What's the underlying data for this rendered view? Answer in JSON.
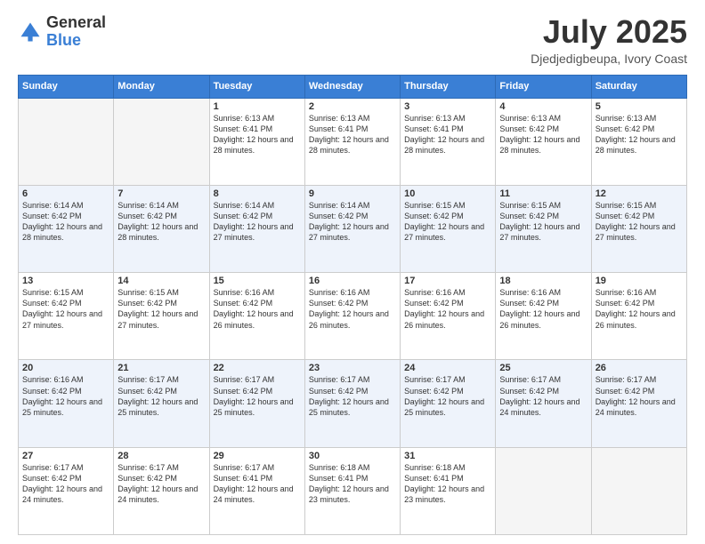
{
  "logo": {
    "text_general": "General",
    "text_blue": "Blue"
  },
  "title": {
    "month_year": "July 2025",
    "location": "Djedjedigbeupa, Ivory Coast"
  },
  "weekdays": [
    "Sunday",
    "Monday",
    "Tuesday",
    "Wednesday",
    "Thursday",
    "Friday",
    "Saturday"
  ],
  "weeks": [
    [
      {
        "day": "",
        "info": ""
      },
      {
        "day": "",
        "info": ""
      },
      {
        "day": "1",
        "info": "Sunrise: 6:13 AM\nSunset: 6:41 PM\nDaylight: 12 hours and 28 minutes."
      },
      {
        "day": "2",
        "info": "Sunrise: 6:13 AM\nSunset: 6:41 PM\nDaylight: 12 hours and 28 minutes."
      },
      {
        "day": "3",
        "info": "Sunrise: 6:13 AM\nSunset: 6:41 PM\nDaylight: 12 hours and 28 minutes."
      },
      {
        "day": "4",
        "info": "Sunrise: 6:13 AM\nSunset: 6:42 PM\nDaylight: 12 hours and 28 minutes."
      },
      {
        "day": "5",
        "info": "Sunrise: 6:13 AM\nSunset: 6:42 PM\nDaylight: 12 hours and 28 minutes."
      }
    ],
    [
      {
        "day": "6",
        "info": "Sunrise: 6:14 AM\nSunset: 6:42 PM\nDaylight: 12 hours and 28 minutes."
      },
      {
        "day": "7",
        "info": "Sunrise: 6:14 AM\nSunset: 6:42 PM\nDaylight: 12 hours and 28 minutes."
      },
      {
        "day": "8",
        "info": "Sunrise: 6:14 AM\nSunset: 6:42 PM\nDaylight: 12 hours and 27 minutes."
      },
      {
        "day": "9",
        "info": "Sunrise: 6:14 AM\nSunset: 6:42 PM\nDaylight: 12 hours and 27 minutes."
      },
      {
        "day": "10",
        "info": "Sunrise: 6:15 AM\nSunset: 6:42 PM\nDaylight: 12 hours and 27 minutes."
      },
      {
        "day": "11",
        "info": "Sunrise: 6:15 AM\nSunset: 6:42 PM\nDaylight: 12 hours and 27 minutes."
      },
      {
        "day": "12",
        "info": "Sunrise: 6:15 AM\nSunset: 6:42 PM\nDaylight: 12 hours and 27 minutes."
      }
    ],
    [
      {
        "day": "13",
        "info": "Sunrise: 6:15 AM\nSunset: 6:42 PM\nDaylight: 12 hours and 27 minutes."
      },
      {
        "day": "14",
        "info": "Sunrise: 6:15 AM\nSunset: 6:42 PM\nDaylight: 12 hours and 27 minutes."
      },
      {
        "day": "15",
        "info": "Sunrise: 6:16 AM\nSunset: 6:42 PM\nDaylight: 12 hours and 26 minutes."
      },
      {
        "day": "16",
        "info": "Sunrise: 6:16 AM\nSunset: 6:42 PM\nDaylight: 12 hours and 26 minutes."
      },
      {
        "day": "17",
        "info": "Sunrise: 6:16 AM\nSunset: 6:42 PM\nDaylight: 12 hours and 26 minutes."
      },
      {
        "day": "18",
        "info": "Sunrise: 6:16 AM\nSunset: 6:42 PM\nDaylight: 12 hours and 26 minutes."
      },
      {
        "day": "19",
        "info": "Sunrise: 6:16 AM\nSunset: 6:42 PM\nDaylight: 12 hours and 26 minutes."
      }
    ],
    [
      {
        "day": "20",
        "info": "Sunrise: 6:16 AM\nSunset: 6:42 PM\nDaylight: 12 hours and 25 minutes."
      },
      {
        "day": "21",
        "info": "Sunrise: 6:17 AM\nSunset: 6:42 PM\nDaylight: 12 hours and 25 minutes."
      },
      {
        "day": "22",
        "info": "Sunrise: 6:17 AM\nSunset: 6:42 PM\nDaylight: 12 hours and 25 minutes."
      },
      {
        "day": "23",
        "info": "Sunrise: 6:17 AM\nSunset: 6:42 PM\nDaylight: 12 hours and 25 minutes."
      },
      {
        "day": "24",
        "info": "Sunrise: 6:17 AM\nSunset: 6:42 PM\nDaylight: 12 hours and 25 minutes."
      },
      {
        "day": "25",
        "info": "Sunrise: 6:17 AM\nSunset: 6:42 PM\nDaylight: 12 hours and 24 minutes."
      },
      {
        "day": "26",
        "info": "Sunrise: 6:17 AM\nSunset: 6:42 PM\nDaylight: 12 hours and 24 minutes."
      }
    ],
    [
      {
        "day": "27",
        "info": "Sunrise: 6:17 AM\nSunset: 6:42 PM\nDaylight: 12 hours and 24 minutes."
      },
      {
        "day": "28",
        "info": "Sunrise: 6:17 AM\nSunset: 6:42 PM\nDaylight: 12 hours and 24 minutes."
      },
      {
        "day": "29",
        "info": "Sunrise: 6:17 AM\nSunset: 6:41 PM\nDaylight: 12 hours and 24 minutes."
      },
      {
        "day": "30",
        "info": "Sunrise: 6:18 AM\nSunset: 6:41 PM\nDaylight: 12 hours and 23 minutes."
      },
      {
        "day": "31",
        "info": "Sunrise: 6:18 AM\nSunset: 6:41 PM\nDaylight: 12 hours and 23 minutes."
      },
      {
        "day": "",
        "info": ""
      },
      {
        "day": "",
        "info": ""
      }
    ]
  ]
}
